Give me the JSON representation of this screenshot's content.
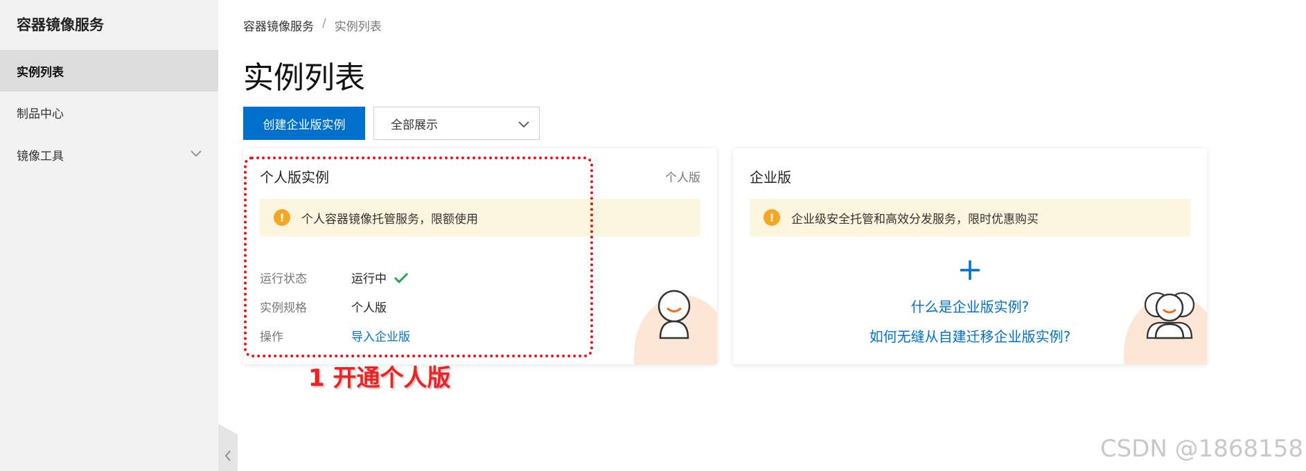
{
  "sidebar": {
    "title": "容器镜像服务",
    "items": [
      {
        "label": "实例列表",
        "active": true
      },
      {
        "label": "制品中心",
        "active": false
      },
      {
        "label": "镜像工具",
        "active": false
      }
    ]
  },
  "breadcrumb": {
    "root": "容器镜像服务",
    "separator": "/",
    "current": "实例列表"
  },
  "page_title": "实例列表",
  "toolbar": {
    "create_label": "创建企业版实例",
    "filter_value": "全部展示"
  },
  "personal_card": {
    "title": "个人版实例",
    "tag": "个人版",
    "notice": "个人容器镜像托管服务，限额使用",
    "fields": [
      {
        "key": "运行状态",
        "value": "运行中"
      },
      {
        "key": "实例规格",
        "value": "个人版"
      },
      {
        "key": "操作",
        "value": "导入企业版"
      }
    ]
  },
  "enterprise_card": {
    "title": "企业版",
    "notice": "企业级安全托管和高效分发服务，限时优惠购买",
    "link1": "什么是企业版实例?",
    "link2": "如何无缝从自建迁移企业版实例?"
  },
  "annotation": "1 开通个人版",
  "watermark": "CSDN @1868158",
  "colors": {
    "primary": "#0070cc",
    "warning": "#f5a623",
    "success": "#22a84a",
    "annotation": "#e11111"
  },
  "icons": [
    "chevron-down-icon",
    "chevron-left-icon",
    "warning-icon",
    "check-icon",
    "plus-icon",
    "user-avatar-icon",
    "users-avatar-icon"
  ]
}
